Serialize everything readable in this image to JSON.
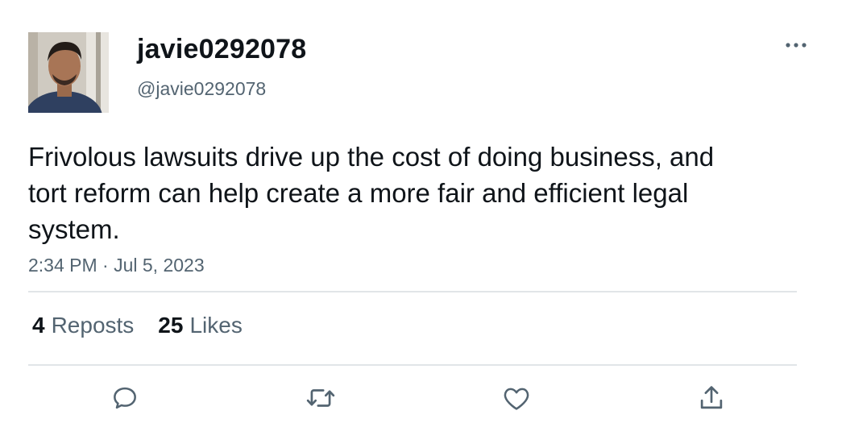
{
  "user": {
    "display_name": "javie0292078",
    "handle": "@javie0292078",
    "avatar_description": "profile-photo"
  },
  "post": {
    "text": "Frivolous lawsuits drive up the cost of doing business, and tort reform can help create a more fair and efficient legal system.",
    "timestamp": "2:34 PM · Jul 5, 2023"
  },
  "stats": {
    "reposts_count": "4",
    "reposts_label": "Reposts",
    "likes_count": "25",
    "likes_label": "Likes"
  },
  "actions": [
    {
      "icon": "reply-icon"
    },
    {
      "icon": "repost-icon"
    },
    {
      "icon": "like-icon"
    },
    {
      "icon": "share-icon"
    }
  ],
  "colors": {
    "text_primary": "#0f1419",
    "text_secondary": "#536471",
    "divider": "#e1e5e8",
    "icon": "#536471"
  }
}
